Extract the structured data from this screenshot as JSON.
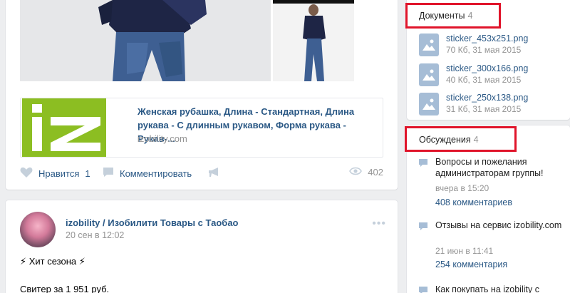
{
  "post1": {
    "link": {
      "title": "Женская рубашка, Длина - Стандартная, Длина рукава - С длинным рукавом, Форма рукава - Рукав-...",
      "domain": "izobility.com",
      "logo_text": "iz"
    },
    "actions": {
      "like_label": "Нравится",
      "like_count": "1",
      "comment_label": "Комментировать",
      "views": "402"
    }
  },
  "post2": {
    "author": "izobility / Изобилити Товары с Таобао",
    "date": "20 сен в 12:02",
    "text_line1": "⚡ Хит сезона ⚡",
    "text_line2": "Свитер за 1 951 руб.",
    "menu": "•••"
  },
  "sidebar": {
    "docs": {
      "title": "Документы",
      "count": "4",
      "items": [
        {
          "name": "sticker_453x251.png",
          "meta": "70 Кб, 31 мая 2015"
        },
        {
          "name": "sticker_300x166.png",
          "meta": "40 Кб, 31 мая 2015"
        },
        {
          "name": "sticker_250x138.png",
          "meta": "31 Кб, 31 мая 2015"
        }
      ]
    },
    "discussions": {
      "title": "Обсуждения",
      "count": "4",
      "items": [
        {
          "title": "Вопросы и пожелания администраторам группы!",
          "date": "вчера в 15:20",
          "comments": "408 комментариев"
        },
        {
          "title": "Отзывы на сервис izobility.com",
          "date": "21 июн в 11:41",
          "comments": "254 комментария"
        },
        {
          "title": "Как покупать на izobility с",
          "date": "",
          "comments": ""
        }
      ]
    }
  },
  "colors": {
    "link": "#2a5885",
    "muted": "#939393",
    "logo_green": "#8cbe22",
    "highlight_red": "#e0142a",
    "bg": "#edeef0"
  }
}
